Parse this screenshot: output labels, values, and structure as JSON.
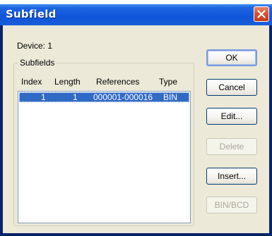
{
  "window": {
    "title": "Subfield"
  },
  "device_label": "Device: 1",
  "subfields": {
    "group_label": "Subfields",
    "columns": [
      "Index",
      "Length",
      "References",
      "Type"
    ],
    "rows": [
      {
        "index": "1",
        "length": "1",
        "references": "000001-000016",
        "type": "BIN",
        "selected": true
      }
    ]
  },
  "buttons": {
    "ok": "OK",
    "cancel": "Cancel",
    "edit": "Edit...",
    "delete": "Delete",
    "insert": "Insert...",
    "bin_bcd": "BIN/BCD"
  },
  "colors": {
    "titlebar": "#0f55da",
    "selection": "#316ac5",
    "dialog_bg": "#ece9d8",
    "close_button": "#d9532f"
  },
  "icons": {
    "close": "close-icon"
  }
}
